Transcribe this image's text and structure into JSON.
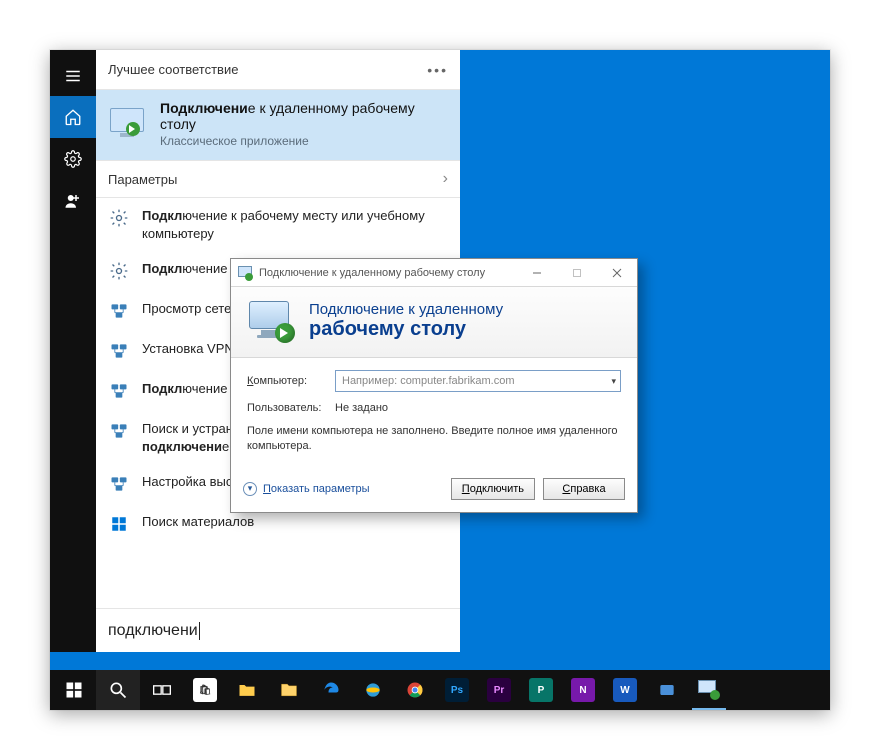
{
  "start": {
    "best_match_header": "Лучшее соответствие",
    "best_match": {
      "title_prefix": "Подключени",
      "title_rest": "е к удаленному рабочему столу",
      "subtitle": "Классическое приложение"
    },
    "params_header": "Параметры",
    "results": [
      {
        "icon": "gear",
        "prefix": "Подкл",
        "rest": "ючение к рабочему месту или учебному компьютеру"
      },
      {
        "icon": "gear",
        "prefix": "Подкл",
        "rest": "ючение компьютера к домену"
      },
      {
        "icon": "net",
        "prefix": "",
        "rest": "Просмотр сетевых подключений"
      },
      {
        "icon": "net",
        "prefix": "",
        "rest": "Установка VPN-подключения"
      },
      {
        "icon": "net",
        "prefix": "Подкл",
        "rest": "ючение к удаленному рабочему столу"
      },
      {
        "icon": "net",
        "prefix": "",
        "rest": "Поиск и устранение проблем с сетью и ",
        "bold": "подключени",
        "tail": "ем"
      },
      {
        "icon": "net",
        "prefix": "",
        "rest": "Настройка высокоскоростного ",
        "bold": "подключени",
        "tail": "я"
      },
      {
        "icon": "win",
        "prefix": "",
        "rest": "Поиск материалов"
      }
    ],
    "search_value": "подключени"
  },
  "dialog": {
    "title": "Подключение к удаленному рабочему столу",
    "banner_line1": "Подключение к удаленному",
    "banner_line2": "рабочему столу",
    "computer_label": "Компьютер:",
    "computer_label_u": "К",
    "computer_placeholder": "Например: computer.fabrikam.com",
    "user_label": "Пользователь:",
    "user_value": "Не задано",
    "info": "Поле имени компьютера не заполнено. Введите полное имя удаленного компьютера.",
    "show_options": "Показать параметры",
    "show_options_u": "П",
    "connect": "Подключить",
    "connect_u": "П",
    "help": "Справка",
    "help_u": "С"
  },
  "taskbar": {
    "apps": [
      "start",
      "search",
      "taskview",
      "store",
      "folder",
      "files",
      "edge",
      "ie",
      "chrome",
      "ps",
      "pr",
      "pub",
      "onenote",
      "word",
      "tool",
      "rdc"
    ]
  }
}
